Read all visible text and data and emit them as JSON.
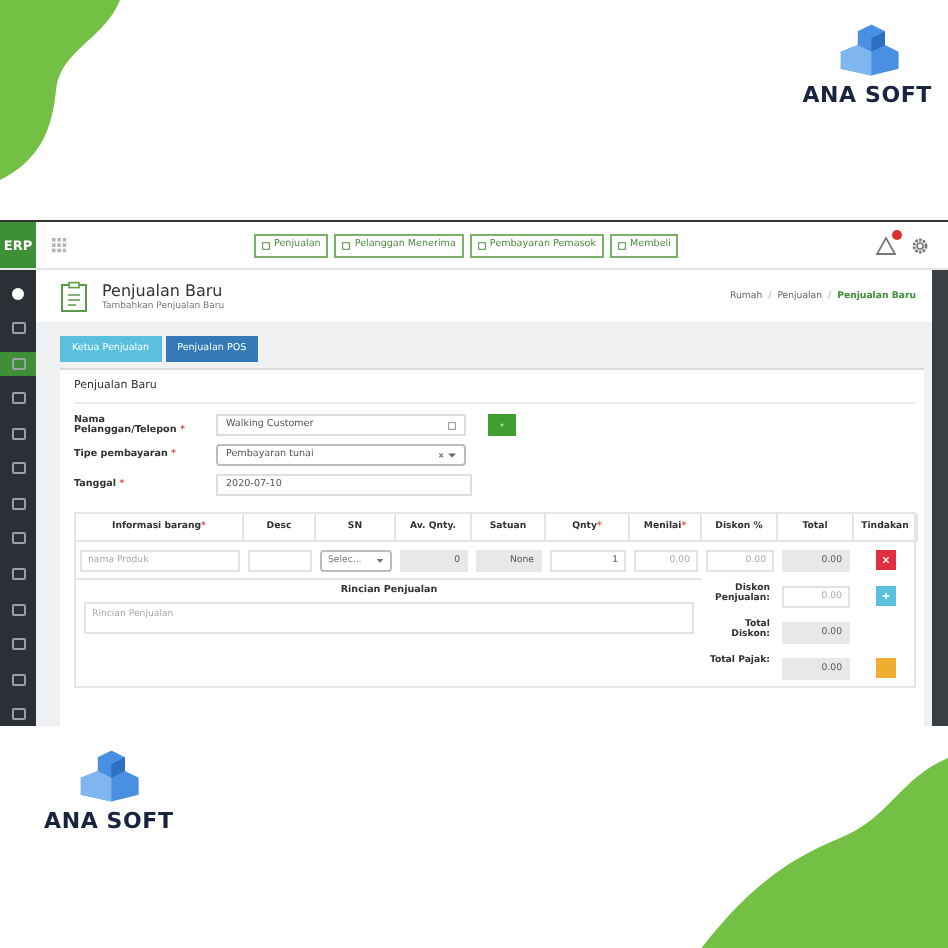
{
  "brand_top": {
    "name": "ANA SOFT"
  },
  "app": {
    "logo": "ERP",
    "nav_buttons": [
      "Penjualan",
      "Pelanggan Menerima",
      "Pembayaran Pemasok",
      "Membeli"
    ],
    "alerts": {
      "badge": true
    },
    "sidebar": {
      "items": [
        {
          "selected": false
        },
        {
          "selected": false
        },
        {
          "selected": true
        },
        {
          "selected": false
        },
        {
          "selected": false
        },
        {
          "selected": false
        },
        {
          "selected": false
        },
        {
          "selected": false
        },
        {
          "selected": false
        },
        {
          "selected": false
        },
        {
          "selected": false
        },
        {
          "selected": false
        },
        {
          "selected": false
        }
      ]
    },
    "page": {
      "title": "Penjualan Baru",
      "subtitle": "Tambahkan Penjualan Baru",
      "separator": "/",
      "breadcrumb": [
        {
          "label": "Rumah",
          "selected": false
        },
        {
          "label": "Penjualan",
          "selected": false
        },
        {
          "label": "Penjualan Baru",
          "selected": true
        }
      ]
    },
    "action_buttons": [
      {
        "label": "Ketua Penjualan",
        "kind": "light"
      },
      {
        "label": "Penjualan POS",
        "kind": "dark"
      }
    ],
    "card_title": "Penjualan Baru",
    "form": [
      {
        "label": "Nama Pelanggan/Telepon",
        "req": "*",
        "kind": "customer",
        "value": "Walking Customer"
      },
      {
        "label": "Tipe pembayaran",
        "req": "*",
        "kind": "select",
        "value": "Pembayaran tunai"
      },
      {
        "label": "Tanggal",
        "req": "*",
        "kind": "date",
        "value": "2020-07-10"
      }
    ],
    "table": {
      "columns": [
        {
          "label": "Informasi barang",
          "req": "*"
        },
        {
          "label": "Desc"
        },
        {
          "label": "SN"
        },
        {
          "label": "Av. Qnty."
        },
        {
          "label": "Satuan"
        },
        {
          "label": "Qnty",
          "req": "*"
        },
        {
          "label": "Menilai",
          "req": "*"
        },
        {
          "label": "Diskon %"
        },
        {
          "label": "Total"
        },
        {
          "label": "Tindakan"
        }
      ],
      "row": {
        "product_placeholder": "nama Produk",
        "sn": "Selec...",
        "av_qnty": "0",
        "satuan": "None",
        "qnty": "1",
        "menilai_placeholder": "0.00",
        "diskon_placeholder": "0.00",
        "total": "0.00"
      },
      "details_title": "Rincian Penjualan",
      "details_placeholder": "Rincian Penjualan",
      "summary": [
        {
          "label": "Diskon Penjualan:",
          "kind": "input",
          "placeholder": "0.00",
          "action": {
            "kind": "add"
          }
        },
        {
          "label": "Total Diskon:",
          "kind": "readonly",
          "value": "0.00"
        },
        {
          "label": "Total Pajak:",
          "kind": "readonly",
          "value": "0.00",
          "action": {
            "kind": "tax"
          }
        }
      ]
    }
  },
  "brand_bottom": {
    "name": "ANA SOFT"
  }
}
